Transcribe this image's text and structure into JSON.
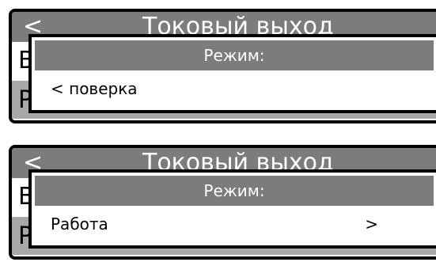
{
  "panel_1": {
    "back": "<",
    "title": "Токовый выход",
    "row1": "В",
    "row2": "Р",
    "popup_title": "Режим:",
    "popup_value": "< поверка",
    "popup_arrow": ""
  },
  "panel_2": {
    "back": "<",
    "title": "Токовый выход",
    "row1": "В",
    "row2": "Р",
    "popup_title": "Режим:",
    "popup_value": "Работа",
    "popup_arrow": ">"
  }
}
